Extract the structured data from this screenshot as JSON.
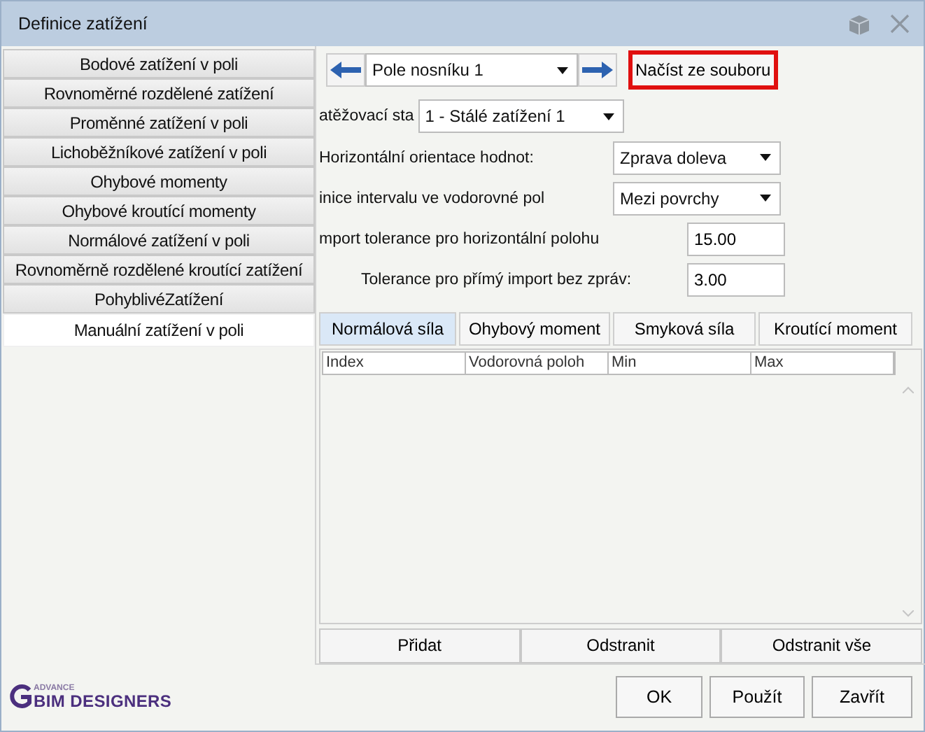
{
  "window": {
    "title": "Definice zatížení"
  },
  "load_types": [
    {
      "label": "Bodové zatížení v poli",
      "selected": false
    },
    {
      "label": "Rovnoměrné rozdělené zatížení",
      "selected": false
    },
    {
      "label": "Proměnné zatížení v poli",
      "selected": false
    },
    {
      "label": "Lichoběžníkové zatížení v poli",
      "selected": false
    },
    {
      "label": "Ohybové momenty",
      "selected": false
    },
    {
      "label": "Ohybové kroutící momenty",
      "selected": false
    },
    {
      "label": "Normálové zatížení v poli",
      "selected": false
    },
    {
      "label": "Rovnoměrně rozdělené kroutící zatížení",
      "selected": false
    },
    {
      "label": "PohyblivéZatížení",
      "selected": false
    },
    {
      "label": "Manuální zatížení v poli",
      "selected": true
    }
  ],
  "span_selector": {
    "value": "Pole nosníku 1"
  },
  "load_button": {
    "label": "Načíst ze souboru",
    "highlighted": true
  },
  "fields": [
    {
      "kind": "dropdown",
      "label": "atěžovací sta",
      "value": "1 - Stálé zatížení 1"
    },
    {
      "kind": "dropdown",
      "label": "Horizontální orientace hodnot:",
      "value": "Zprava doleva"
    },
    {
      "kind": "dropdown",
      "label": "inice intervalu ve vodorovné pol",
      "value": "Mezi povrchy"
    },
    {
      "kind": "text",
      "label": "mport tolerance pro horizontální polohu",
      "value": "15.00"
    },
    {
      "kind": "text",
      "label": "Tolerance pro přímý import bez zpráv:",
      "value": "3.00"
    }
  ],
  "tabs": [
    {
      "label": "Normálová síla",
      "selected": true
    },
    {
      "label": "Ohybový moment",
      "selected": false
    },
    {
      "label": "Smyková síla",
      "selected": false
    },
    {
      "label": "Kroutící moment",
      "selected": false
    }
  ],
  "table": {
    "columns": [
      "Index",
      "Vodorovná poloh",
      "Min",
      "Max"
    ]
  },
  "table_buttons": [
    "Přidat",
    "Odstranit",
    "Odstranit vše"
  ],
  "logo": {
    "small": "ADVANCE",
    "main": "BIM DESIGNERS"
  },
  "buttons": [
    "OK",
    "Použít",
    "Zavřít"
  ]
}
